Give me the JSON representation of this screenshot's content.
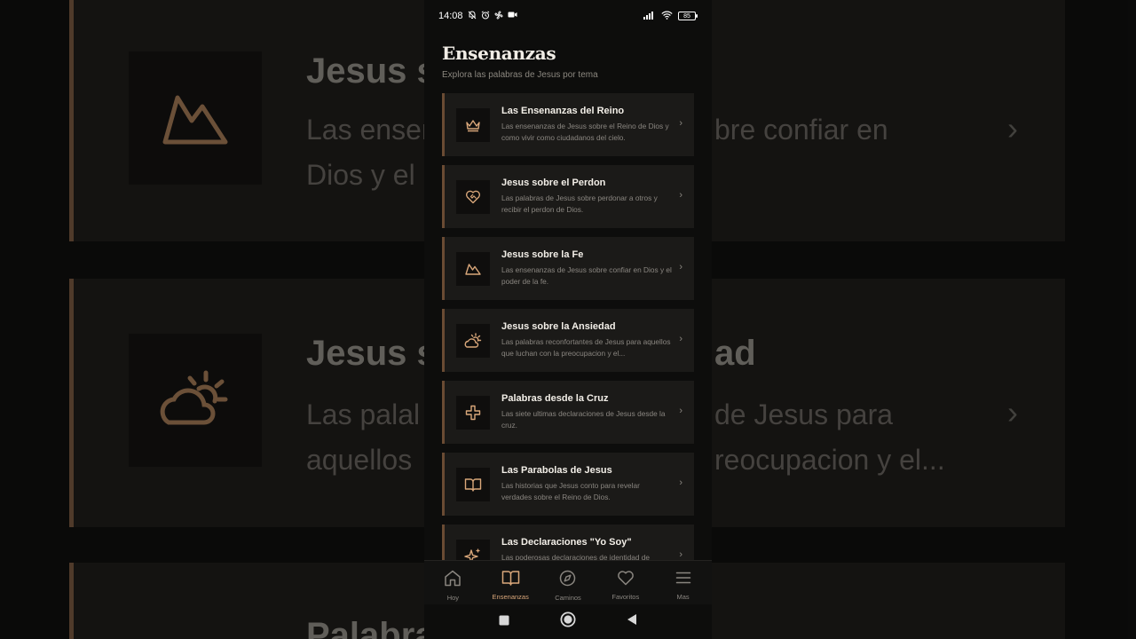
{
  "background": {
    "cards": [
      {
        "title": "Jesus s",
        "desc_lines": [
          "Las ensen",
          "Dios y el"
        ],
        "desc_right": "bre confiar en"
      },
      {
        "title": "Jesus s",
        "title_right": "ad",
        "desc_lines": [
          "Las palal",
          "aquellos"
        ],
        "desc_right_lines": [
          "de Jesus para",
          "reocupacion y el..."
        ]
      },
      {
        "title": "Palabra",
        "desc_lines": []
      }
    ]
  },
  "status_bar": {
    "time": "14:08",
    "battery": "85"
  },
  "header": {
    "title": "Ensenanzas",
    "subtitle": "Explora las palabras de Jesus por tema"
  },
  "topics": [
    {
      "icon": "crown-icon",
      "title": "Las Ensenanzas del Reino",
      "desc": "Las ensenanzas de Jesus sobre el Reino de Dios y como vivir como ciudadanos del cielo."
    },
    {
      "icon": "heart-handshake-icon",
      "title": "Jesus sobre el Perdon",
      "desc": "Las palabras de Jesus sobre perdonar a otros y recibir el perdon de Dios."
    },
    {
      "icon": "mountain-icon",
      "title": "Jesus sobre la Fe",
      "desc": "Las ensenanzas de Jesus sobre confiar en Dios y el poder de la fe."
    },
    {
      "icon": "sun-cloud-icon",
      "title": "Jesus sobre la Ansiedad",
      "desc": "Las palabras reconfortantes de Jesus para aquellos que luchan con la preocupacion y el..."
    },
    {
      "icon": "cross-icon",
      "title": "Palabras desde la Cruz",
      "desc": "Las siete ultimas declaraciones de Jesus desde la cruz."
    },
    {
      "icon": "open-book-icon",
      "title": "Las Parabolas de Jesus",
      "desc": "Las historias que Jesus conto para revelar verdades sobre el Reino de Dios."
    },
    {
      "icon": "sparkles-icon",
      "title": "Las Declaraciones \"Yo Soy\"",
      "desc": "Las poderosas declaraciones de identidad de"
    }
  ],
  "tabs": [
    {
      "icon": "home-icon",
      "label": "Hoy",
      "active": false
    },
    {
      "icon": "book-icon",
      "label": "Ensenanzas",
      "active": true
    },
    {
      "icon": "compass-icon",
      "label": "Caminos",
      "active": false
    },
    {
      "icon": "heart-icon",
      "label": "Favoritos",
      "active": false
    },
    {
      "icon": "menu-icon",
      "label": "Mas",
      "active": false
    }
  ],
  "colors": {
    "accent": "#d9a77a",
    "card_border": "#6a4b33",
    "card_bg": "#1b1a18"
  }
}
